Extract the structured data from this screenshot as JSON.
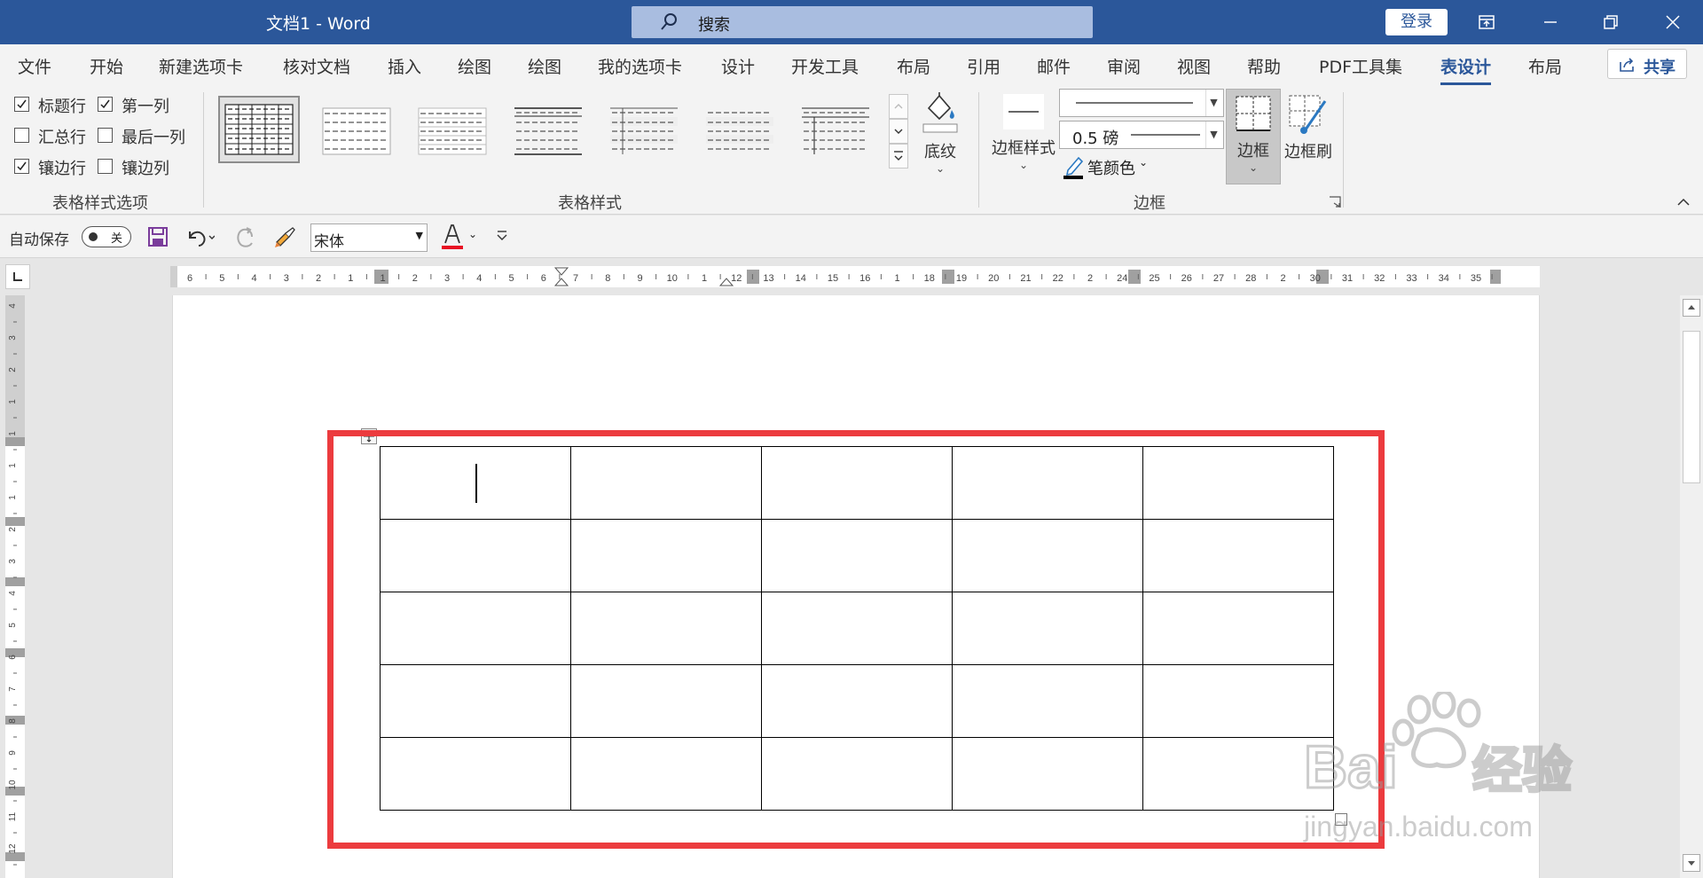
{
  "titlebar": {
    "title": "文档1  -  Word",
    "search_placeholder": "搜索",
    "login_label": "登录"
  },
  "menu": {
    "items": [
      "文件",
      "开始",
      "新建选项卡",
      "核对文档",
      "插入",
      "绘图",
      "绘图",
      "我的选项卡",
      "设计",
      "开发工具",
      "布局",
      "引用",
      "邮件",
      "审阅",
      "视图",
      "帮助",
      "PDF工具集",
      "表设计",
      "布局"
    ],
    "active": "表设计",
    "share_label": "共享"
  },
  "ribbon": {
    "style_options": {
      "items": [
        {
          "label": "标题行",
          "checked": true
        },
        {
          "label": "第一列",
          "checked": true
        },
        {
          "label": "汇总行",
          "checked": false
        },
        {
          "label": "最后一列",
          "checked": false
        },
        {
          "label": "镶边行",
          "checked": true
        },
        {
          "label": "镶边列",
          "checked": false
        }
      ],
      "group_label": "表格样式选项"
    },
    "table_styles": {
      "group_label": "表格样式",
      "shading_label": "底纹"
    },
    "borders": {
      "border_styles_label": "边框样式",
      "weight_value": "0.5 磅",
      "pen_color_label": "笔颜色",
      "borders_label": "边框",
      "border_painter_label": "边框刷",
      "group_label": "边框"
    }
  },
  "qat": {
    "autosave_label": "自动保存",
    "toggle_state": "关",
    "font_name": "宋体"
  },
  "ruler": {
    "horizontal_labels": [
      "6",
      "5",
      "4",
      "3",
      "2",
      "1",
      "1",
      "2",
      "3",
      "4",
      "5",
      "6",
      "7",
      "8",
      "9",
      "10",
      "1",
      "12",
      "13",
      "14",
      "15",
      "16",
      "1",
      "18",
      "19",
      "20",
      "21",
      "22",
      "2",
      "24",
      "25",
      "26",
      "27",
      "28",
      "2",
      "30",
      "31",
      "32",
      "33",
      "34",
      "35"
    ],
    "vertical_labels": [
      "4",
      "3",
      "2",
      "1",
      "1",
      "1",
      "1",
      "2",
      "3",
      "4",
      "5",
      "6",
      "7",
      "8",
      "9",
      "10",
      "11",
      "12"
    ]
  },
  "document": {
    "table": {
      "rows": 5,
      "columns": 5
    }
  },
  "watermark": {
    "text": "Bai du 经验",
    "url": "jingyan.baidu.com"
  },
  "colors": {
    "brand": "#2b579a",
    "highlight": "#ec3b3e",
    "font_color_bar": "#e81123"
  }
}
